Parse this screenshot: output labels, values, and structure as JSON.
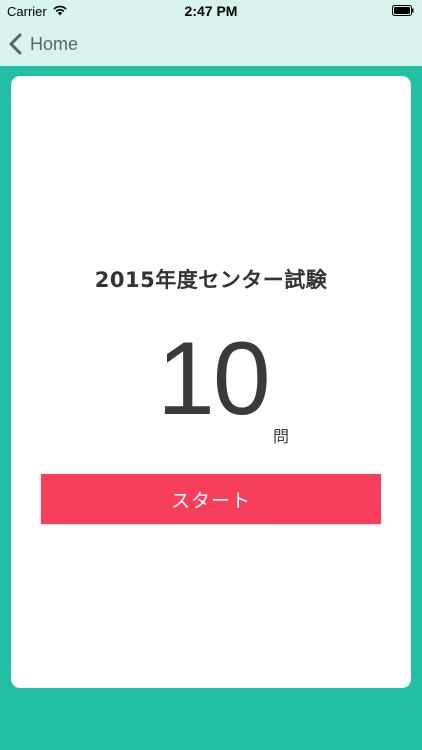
{
  "status_bar": {
    "carrier": "Carrier",
    "time": "2:47 PM",
    "wifi_icon": "wifi-icon",
    "battery_icon": "battery-icon"
  },
  "nav": {
    "back_label": "Home",
    "back_icon": "chevron-left-icon"
  },
  "card": {
    "title": "2015年度センター試験",
    "count": "10",
    "unit": "問",
    "start_label": "スタート"
  },
  "colors": {
    "background": "#22bfa4",
    "nav_bar": "#d8f2ee",
    "card": "#ffffff",
    "start_button": "#f73f5b"
  }
}
